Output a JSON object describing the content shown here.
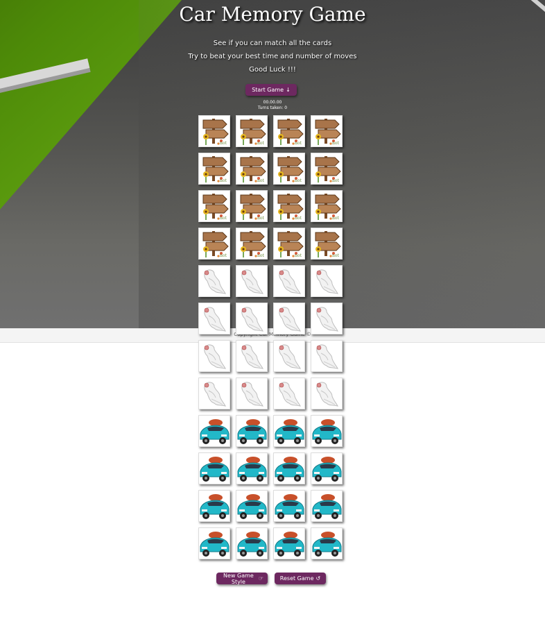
{
  "header": {
    "title": "Car Memory Game",
    "intro_lines": [
      "See if you can match all the cards",
      "Try to beat your best time and number of moves",
      "Good Luck !!!"
    ]
  },
  "controls": {
    "start_label": "Start Game",
    "start_icon": "arrow-down-icon",
    "new_style_label": "New Game Style",
    "new_style_icon": "hand-point-icon",
    "reset_label": "Reset Game",
    "reset_icon": "undo-icon"
  },
  "stats": {
    "timer": "00.00.00",
    "turns": "Turns taken: 0"
  },
  "footer": {
    "text": "Copyright Car Memory Game ©"
  },
  "cards": {
    "rows": [
      [
        "signpost",
        "signpost",
        "signpost",
        "signpost"
      ],
      [
        "signpost",
        "signpost",
        "signpost",
        "signpost"
      ],
      [
        "signpost",
        "signpost",
        "signpost",
        "signpost"
      ],
      [
        "signpost",
        "signpost",
        "signpost",
        "signpost"
      ],
      [
        "ghost",
        "ghost",
        "ghost",
        "ghost"
      ],
      [
        "ghost",
        "ghost",
        "ghost",
        "ghost"
      ],
      [
        "ghost",
        "ghost",
        "ghost",
        "ghost"
      ],
      [
        "ghost",
        "ghost",
        "ghost",
        "ghost"
      ],
      [
        "car",
        "car",
        "car",
        "car"
      ],
      [
        "car",
        "car",
        "car",
        "car"
      ],
      [
        "car",
        "car",
        "car",
        "car"
      ],
      [
        "car",
        "car",
        "car",
        "car"
      ]
    ]
  },
  "colors": {
    "button_bg": "#6d2860",
    "grass": "#4d8a08",
    "road": "#5a5a58"
  }
}
